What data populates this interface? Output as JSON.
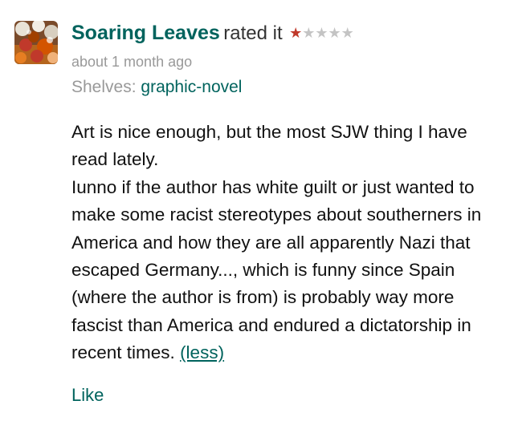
{
  "review": {
    "reviewer_name": "Soaring Leaves",
    "rated_text": "rated it",
    "rating": 1,
    "max_rating": 5,
    "star_glyph": "★",
    "date": "about 1 month ago",
    "shelves_label": "Shelves:",
    "shelf": "graphic-novel",
    "paragraph_1": "Art is nice enough, but the most SJW thing I have read lately.",
    "paragraph_2": "Iunno if the author has white guilt or just wanted to make some racist stereotypes about southerners in America and how they are all apparently Nazi that escaped Germany..., which is funny since Spain (where the author is from) is probably way more fascist than America and endured a dictatorship in recent times.",
    "less_link": "(less)",
    "like_label": "Like"
  },
  "colors": {
    "link_green": "#00635d",
    "star_filled": "#c0392b",
    "star_empty": "#c4c4c4",
    "meta_gray": "#999999"
  },
  "icons": {
    "avatar": "autumn-leaves-avatar"
  }
}
